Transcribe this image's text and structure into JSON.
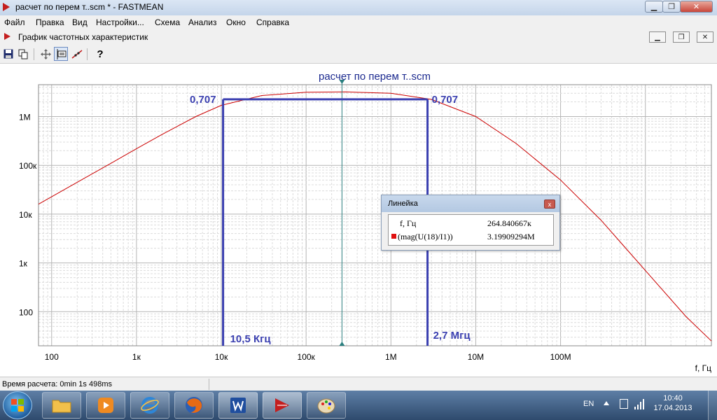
{
  "window": {
    "title": "расчет по перем т..scm * - FASTMEAN"
  },
  "menu": [
    "Файл",
    "Правка",
    "Вид",
    "Настройки...",
    "Схема",
    "Анализ",
    "Окно",
    "Справка"
  ],
  "subwindow": {
    "title": "График частотных характеристик"
  },
  "toolbar": {
    "help_label": "?"
  },
  "chart_data": {
    "type": "line",
    "title": "расчет по перем т..scm",
    "xlabel": "f, Гц",
    "ylabel": "",
    "x_scale": "log",
    "y_scale": "log",
    "xlim": [
      70,
      6000000000
    ],
    "ylim": [
      20,
      4500000
    ],
    "x_ticks": [
      100,
      1000,
      10000,
      100000,
      1000000,
      10000000,
      100000000
    ],
    "x_tick_labels": [
      "100",
      "1к",
      "10к",
      "100к",
      "1M",
      "10M",
      "100M"
    ],
    "y_ticks": [
      100,
      1000,
      10000,
      100000,
      1000000
    ],
    "y_tick_labels": [
      "100",
      "1к",
      "10к",
      "100к",
      "1M"
    ],
    "grid": true,
    "series": [
      {
        "name": "(mag(U(18)/I1))",
        "color": "#cc0000",
        "x": [
          70,
          200,
          500,
          1000,
          2000,
          5000,
          10000,
          30000,
          100000,
          300000,
          1000000,
          3000000,
          10000000,
          30000000,
          100000000,
          300000000,
          1000000000,
          3000000000,
          6000000000
        ],
        "y": [
          16000,
          45000,
          110000,
          220000,
          430000,
          1000000,
          1700000,
          2700000,
          3150000,
          3200000,
          3000000,
          2250000,
          1000000,
          280000,
          50000,
          7500,
          700,
          80,
          25
        ]
      }
    ],
    "annotations": [
      {
        "text": "0,707",
        "side": "left"
      },
      {
        "text": "0,707",
        "side": "right"
      },
      {
        "text": "10,5 Кгц",
        "x": 10500
      },
      {
        "text": "2,7 Мгц",
        "x": 2700000
      }
    ],
    "cursor_x": 264840.667,
    "accent_color": "#3a3fb0"
  },
  "ruler": {
    "title": "Линейка",
    "close": "x",
    "row1_label": "f, Гц",
    "row1_value": "264.840667к",
    "row2_label": "(mag(U(18)/I1))",
    "row2_value": "3.19909294M"
  },
  "status": {
    "text": "Время расчета: 0min 1s 498ms"
  },
  "tray": {
    "lang": "EN",
    "time": "10:40",
    "date": "17.04.2013"
  }
}
